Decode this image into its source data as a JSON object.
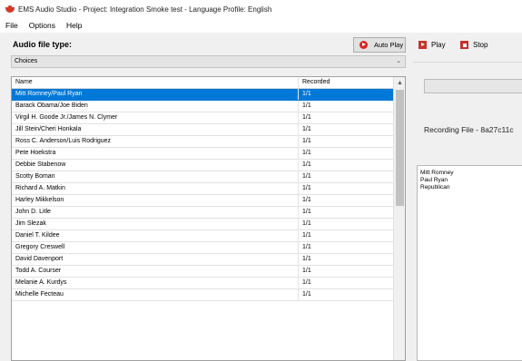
{
  "window": {
    "title": "EMS Audio Studio - Project: Integration Smoke test - Language Profile: English"
  },
  "menu": {
    "file": "File",
    "options": "Options",
    "help": "Help"
  },
  "audio_panel": {
    "label": "Audio file type:",
    "auto_play_label": "Auto Play",
    "selected_type": "Choices"
  },
  "grid": {
    "columns": [
      "Name",
      "Recorded"
    ],
    "rows": [
      {
        "name": "Mitt Romney/Paul Ryan",
        "recorded": "1/1"
      },
      {
        "name": "Barack Obama/Joe Biden",
        "recorded": "1/1"
      },
      {
        "name": "Virgil H. Goode Jr./James N. Clymer",
        "recorded": "1/1"
      },
      {
        "name": "Jill Stein/Cheri Honkala",
        "recorded": "1/1"
      },
      {
        "name": "Ross C. Anderson/Luis Rodriguez",
        "recorded": "1/1"
      },
      {
        "name": "Pete Hoekstra",
        "recorded": "1/1"
      },
      {
        "name": "Debbie Stabenow",
        "recorded": "1/1"
      },
      {
        "name": "Scotty Boman",
        "recorded": "1/1"
      },
      {
        "name": "Richard A. Matkin",
        "recorded": "1/1"
      },
      {
        "name": "Harley Mikkelson",
        "recorded": "1/1"
      },
      {
        "name": "John D. Litle",
        "recorded": "1/1"
      },
      {
        "name": "Jim Slezak",
        "recorded": "1/1"
      },
      {
        "name": "Daniel T. Kildee",
        "recorded": "1/1"
      },
      {
        "name": "Gregory Creswell",
        "recorded": "1/1"
      },
      {
        "name": "David Davenport",
        "recorded": "1/1"
      },
      {
        "name": "Todd A. Courser",
        "recorded": "1/1"
      },
      {
        "name": "Melanie A. Kurdys",
        "recorded": "1/1"
      },
      {
        "name": "Michelle Fecteau",
        "recorded": "1/1"
      }
    ],
    "selected_index": 0
  },
  "player": {
    "play_label": "Play",
    "stop_label": "Stop",
    "recording_file": "Recording File - 8a27c11c",
    "script_lines": [
      "Mitt Romney",
      "Paul Ryan",
      "Republican"
    ]
  },
  "colors": {
    "selection": "#0078d7",
    "record_red": "#d7261e"
  }
}
